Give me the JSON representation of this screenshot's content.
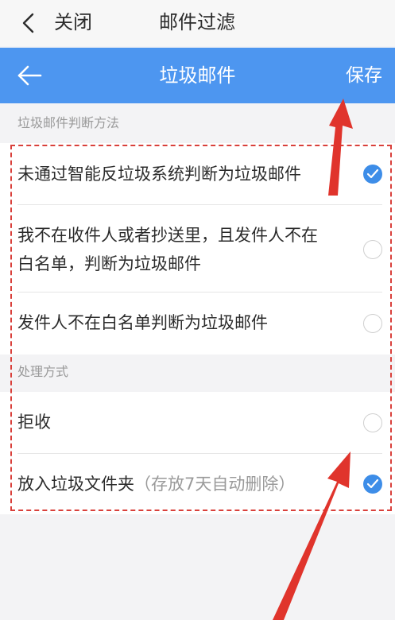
{
  "topbar": {
    "close_label": "关闭",
    "title": "邮件过滤"
  },
  "header": {
    "title": "垃圾邮件",
    "save_label": "保存"
  },
  "section_method": {
    "label": "垃圾邮件判断方法",
    "options": [
      {
        "line1": "未通过智能反垃圾系统判断为垃圾邮件",
        "checked": true
      },
      {
        "line1": "我不在收件人或者抄送里，且发件人不在",
        "line2": "白名单，判断为垃圾邮件",
        "checked": false
      },
      {
        "line1": "发件人不在白名单判断为垃圾邮件",
        "checked": false
      }
    ]
  },
  "section_handling": {
    "label": "处理方式",
    "options": [
      {
        "line1": "拒收",
        "checked": false
      },
      {
        "line1": "放入垃圾文件夹",
        "hint": "（存放7天自动删除）",
        "checked": true
      }
    ]
  },
  "colors": {
    "header_bg": "#4d96f0",
    "check_on": "#3d8de8",
    "annotation": "#d9403b"
  },
  "icons": [
    "chevron-left-icon",
    "arrow-left-icon",
    "checkmark-icon",
    "radio-empty-icon",
    "annotation-arrow-icon"
  ]
}
